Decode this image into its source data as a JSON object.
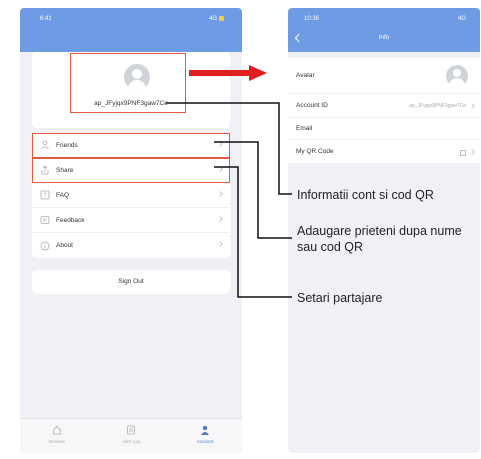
{
  "left": {
    "status_time": "6:41",
    "status_right": "4G",
    "account_id": "ap_JFyjqx9PNF3gaw7Ce",
    "menu": [
      {
        "label": "Friends",
        "icon": "person-icon"
      },
      {
        "label": "Share",
        "icon": "share-icon"
      },
      {
        "label": "FAQ",
        "icon": "faq-icon"
      },
      {
        "label": "Feedback",
        "icon": "feedback-icon"
      },
      {
        "label": "About",
        "icon": "about-icon"
      }
    ],
    "sign_out": "Sign Out",
    "tabs": [
      {
        "label": "Devices",
        "icon": "home-icon"
      },
      {
        "label": "Alert Log",
        "icon": "log-icon"
      },
      {
        "label": "Account",
        "icon": "person-icon"
      }
    ]
  },
  "right": {
    "status_time": "10:36",
    "status_right": "4G",
    "title": "Info",
    "rows": [
      {
        "label": "Avatar",
        "value": ""
      },
      {
        "label": "Account ID",
        "value": "ap_JFyjqx9PNF3gaw7Ce"
      },
      {
        "label": "Email",
        "value": ""
      },
      {
        "label": "My QR Code",
        "value": ""
      }
    ]
  },
  "captions": {
    "info": "Informatii cont si cod QR",
    "friends": "Adaugare prieteni dupa nume sau cod QR",
    "share": "Setari partajare"
  },
  "colors": {
    "header_blue": "#6f9be4",
    "highlight_red": "#e05a3c",
    "arrow_red": "#e02020"
  }
}
